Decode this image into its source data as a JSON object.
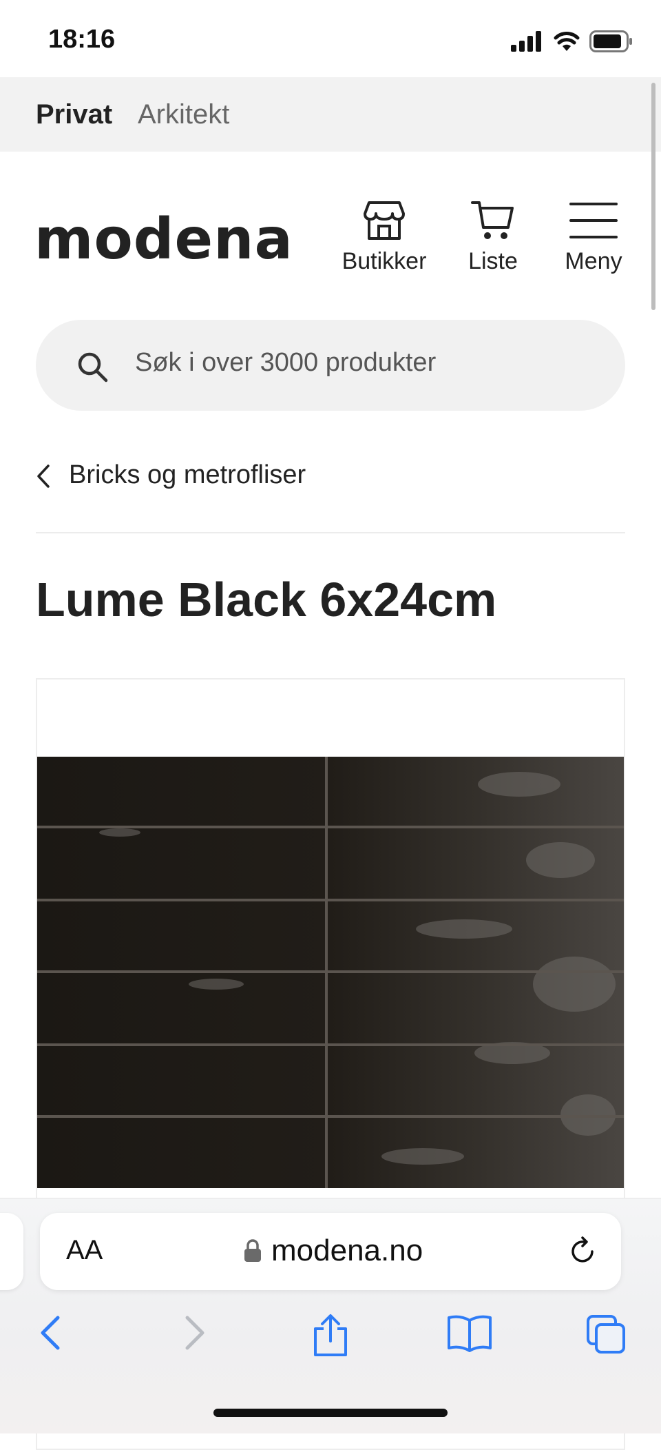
{
  "status_bar": {
    "time": "18:16"
  },
  "top_tabs": [
    "Privat",
    "Arkitekt"
  ],
  "header": {
    "logo": "modena",
    "actions": [
      {
        "label": "Butikker",
        "icon": "store-icon"
      },
      {
        "label": "Liste",
        "icon": "cart-icon"
      },
      {
        "label": "Meny",
        "icon": "hamburger-menu-icon"
      }
    ]
  },
  "search": {
    "placeholder": "Søk i over 3000 produkter"
  },
  "breadcrumb": {
    "back_label": "Bricks og metrofliser"
  },
  "product": {
    "title": "Lume Black 6x24cm",
    "image": "black glazed subway tiles"
  },
  "browser": {
    "text_size_label": "AA",
    "url": "modena.no",
    "toolbar": [
      "back-icon",
      "forward-icon",
      "share-icon",
      "bookmarks-icon",
      "tabs-icon"
    ]
  },
  "colors": {
    "tab_bar_bg": "#f2f2f2",
    "search_bg": "#f1f1f1",
    "text_dark": "#222222",
    "safari_blue": "#2f7cf6",
    "tile_dark": "#1c1915"
  }
}
